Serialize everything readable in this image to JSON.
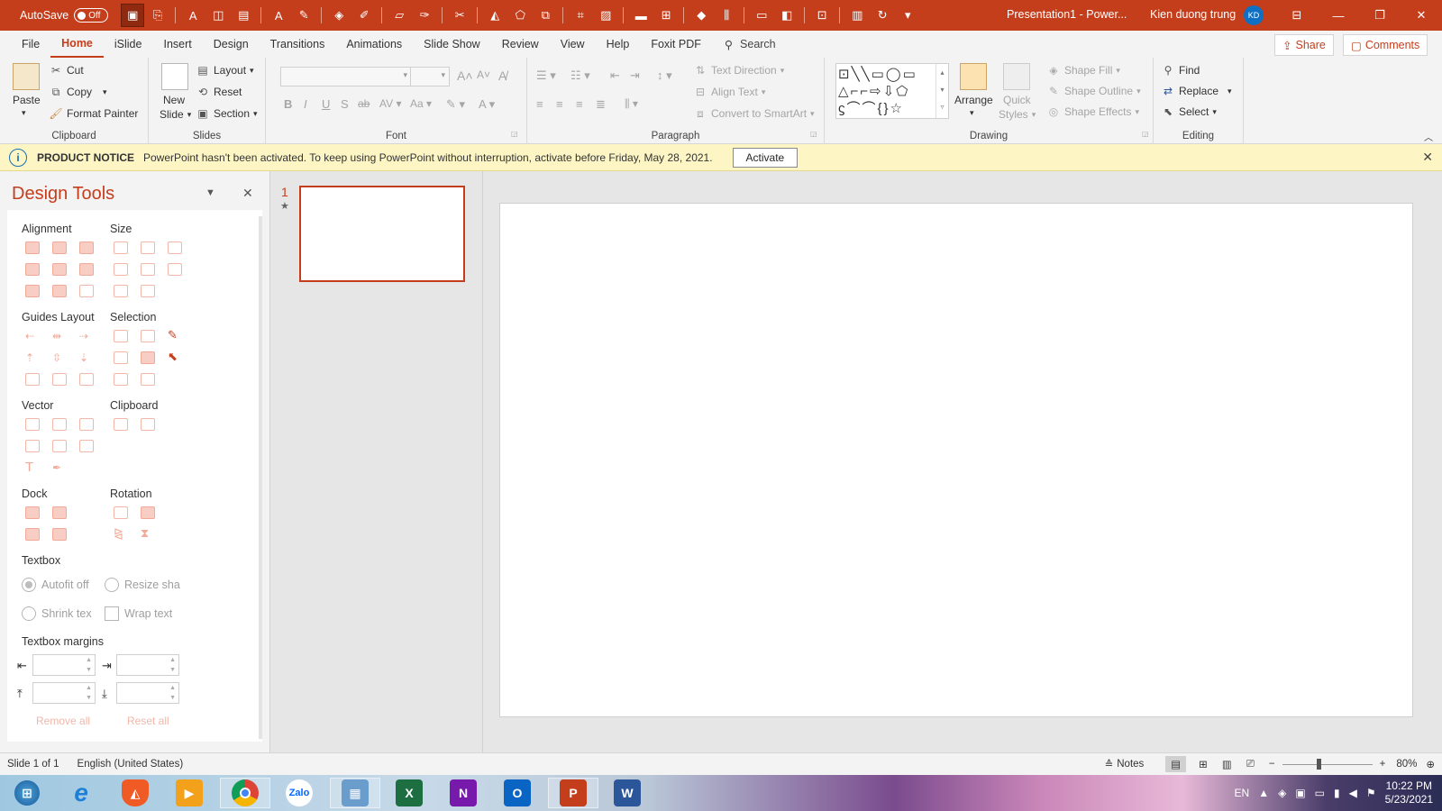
{
  "title_bar": {
    "autosave_label": "AutoSave",
    "autosave_state": "Off",
    "document_title": "Presentation1  -  Power...",
    "user_name": "Kien duong trung",
    "user_initials": "KD",
    "accent_color": "#c43e1c"
  },
  "menu": {
    "tabs": [
      "File",
      "Home",
      "iSlide",
      "Insert",
      "Design",
      "Transitions",
      "Animations",
      "Slide Show",
      "Review",
      "View",
      "Help",
      "Foxit PDF"
    ],
    "active_tab": "Home",
    "search_label": "Search",
    "share_label": "Share",
    "comments_label": "Comments"
  },
  "ribbon": {
    "clipboard": {
      "label": "Clipboard",
      "paste": "Paste",
      "cut": "Cut",
      "copy": "Copy",
      "format_painter": "Format Painter"
    },
    "slides": {
      "label": "Slides",
      "new_slide_1": "New",
      "new_slide_2": "Slide",
      "layout": "Layout",
      "reset": "Reset",
      "section": "Section"
    },
    "font": {
      "label": "Font",
      "font_name": "",
      "font_size": ""
    },
    "paragraph": {
      "label": "Paragraph",
      "text_direction": "Text Direction",
      "align_text": "Align Text",
      "convert_smartart": "Convert to SmartArt"
    },
    "drawing": {
      "label": "Drawing",
      "arrange": "Arrange",
      "quick_styles_1": "Quick",
      "quick_styles_2": "Styles",
      "shape_fill": "Shape Fill",
      "shape_outline": "Shape Outline",
      "shape_effects": "Shape Effects"
    },
    "editing": {
      "label": "Editing",
      "find": "Find",
      "replace": "Replace",
      "select": "Select"
    }
  },
  "notice": {
    "title": "PRODUCT NOTICE",
    "message": "PowerPoint hasn't been activated. To keep using PowerPoint without interruption, activate before Friday, May 28, 2021.",
    "button": "Activate"
  },
  "design_tools": {
    "title": "Design Tools",
    "sections": {
      "alignment": "Alignment",
      "size": "Size",
      "guides_layout": "Guides Layout",
      "selection": "Selection",
      "vector": "Vector",
      "clipboard": "Clipboard",
      "dock": "Dock",
      "rotation": "Rotation",
      "textbox": "Textbox",
      "textbox_margins": "Textbox margins"
    },
    "options": {
      "autofit_off": "Autofit off",
      "resize_shape": "Resize sha",
      "shrink_text": "Shrink tex",
      "wrap_text": "Wrap text"
    },
    "remove_all": "Remove all",
    "reset_all": "Reset all"
  },
  "thumbnails": {
    "slide_number": "1",
    "marker": "★"
  },
  "status": {
    "slide_info": "Slide 1 of 1",
    "language": "English (United States)",
    "notes": "Notes",
    "zoom": "80%"
  },
  "taskbar": {
    "zalo": "Zalo",
    "lang": "EN",
    "time": "10:22 PM",
    "date": "5/23/2021"
  }
}
